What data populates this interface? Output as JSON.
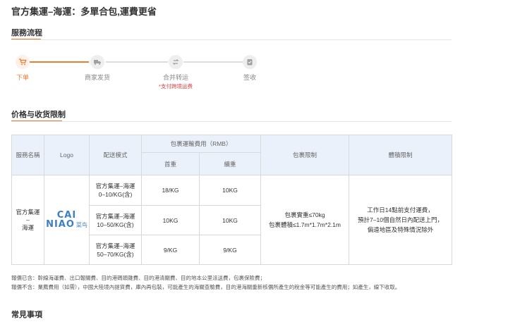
{
  "page": {
    "title": "官方集運–海運：多單合包,運費更省"
  },
  "process": {
    "title": "服務流程",
    "steps": [
      {
        "label": "下单",
        "icon": "cart-icon",
        "active": true
      },
      {
        "label": "商家发货",
        "icon": "truck-icon",
        "active": false
      },
      {
        "label": "合并转运",
        "icon": "transfer-icon",
        "active": false,
        "note": "*支付跨境运费"
      },
      {
        "label": "签收",
        "icon": "clipboard-check-icon",
        "active": false
      }
    ],
    "accent_color": "#f07a2e"
  },
  "pricing": {
    "title": "价格与收货限制",
    "headers": {
      "service_name": "服務名稱",
      "logo": "Logo",
      "mode": "配送模式",
      "fee_group": "包裹運輸費用（RMB）",
      "first_weight": "首重",
      "extra_weight": "續重",
      "package_limit": "包裹限制",
      "volume_limit": "體積限制"
    },
    "service": {
      "name_line1": "官方集運",
      "name_line2": "–",
      "name_line3": "海運",
      "logo_text_top": "CAI",
      "logo_text_bottom": "NIAO",
      "logo_cn": "菜鸟"
    },
    "rows": [
      {
        "mode_line1": "官方集運–海運",
        "mode_line2": "0–10/KG(含)",
        "first": "18/KG",
        "extra": "10KG"
      },
      {
        "mode_line1": "官方集運–海運",
        "mode_line2": "10–50/KG(含)",
        "first": "10KG",
        "extra": "10KG"
      },
      {
        "mode_line1": "官方集運–海運",
        "mode_line2": "50–70/KG(含)",
        "first": "9/KG",
        "extra": "9/KG"
      }
    ],
    "package_limit_line1": "包裹實重≤70kg",
    "package_limit_line2": "包裹體積≤1.7m*1.7m*2.1m",
    "volume_limit_line1": "工作日14點前支付運費，",
    "volume_limit_line2": "預計7–10個自然日內配送上門，",
    "volume_limit_line3": "偏遠地區及特殊情況除外",
    "header_bg": "#eaf1fb"
  },
  "notes": {
    "included": "報價已含：幹線海運費、出口報關費、目的港碼頭雜費、目的港清關費、目的地本公里派送費，包裹保險費；",
    "excluded": "報價不含：業薦費用（如需），中國大陸境內提貨費，庫內再包裝，可能產生的海關查驗費，目的港海關重新核價所產生的稅金等可能產生的費用；如產生，線下收取。"
  },
  "faq": {
    "title": "常見事項"
  }
}
